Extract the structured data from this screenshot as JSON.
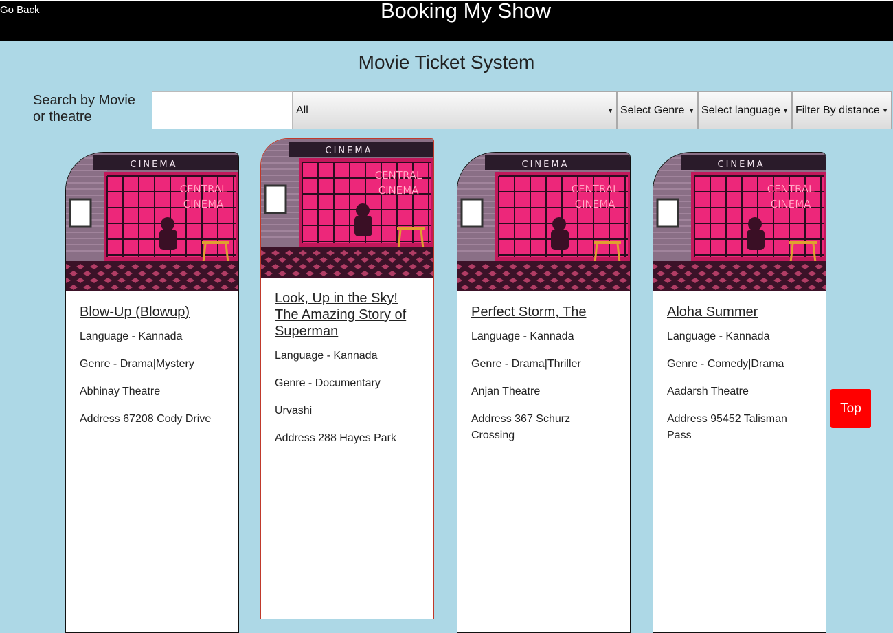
{
  "header": {
    "go_back": "Go Back",
    "site_title": "Booking My Show"
  },
  "page_title": "Movie Ticket System",
  "search": {
    "label": "Search by Movie or theatre",
    "value": ""
  },
  "filters": {
    "category": "All",
    "genre": "Select Genre",
    "language": "Select language",
    "distance": "Filter By distance"
  },
  "cards": [
    {
      "title": "Blow-Up (Blowup)",
      "language": "Language - Kannada",
      "genre": "Genre - Drama|Mystery",
      "theatre": "Abhinay Theatre",
      "address": "Address 67208 Cody Drive"
    },
    {
      "title": "Look, Up in the Sky! The Amazing Story of Superman",
      "language": "Language - Kannada",
      "genre": "Genre - Documentary",
      "theatre": "Urvashi",
      "address": "Address 288 Hayes Park"
    },
    {
      "title": "Perfect Storm, The",
      "language": "Language - Kannada",
      "genre": "Genre - Drama|Thriller",
      "theatre": "Anjan Theatre",
      "address": "Address 367 Schurz Crossing"
    },
    {
      "title": "Aloha Summer",
      "language": "Language - Kannada",
      "genre": "Genre - Comedy|Drama",
      "theatre": "Aadarsh Theatre",
      "address": "Address 95452 Talisman Pass"
    }
  ],
  "poster": {
    "marquee": "CINEMA",
    "neon_line1": "CENTRAL",
    "neon_line2": "CINEMA",
    "neon_color": "#ff3a7d"
  },
  "top_button": "Top",
  "colors": {
    "background": "#add8e6",
    "header": "#000000",
    "top_button": "#ff0000"
  }
}
